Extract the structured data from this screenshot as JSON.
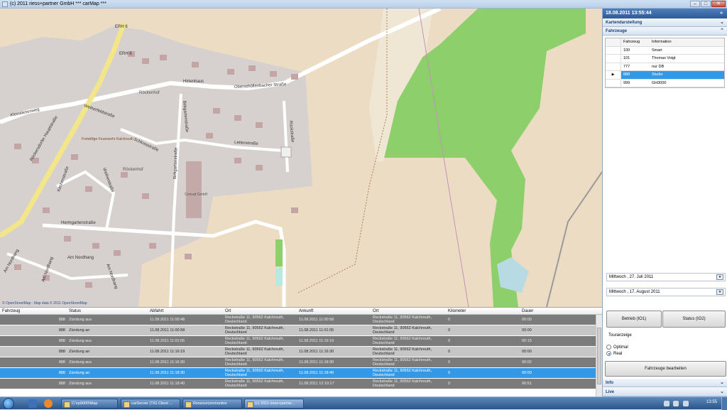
{
  "window": {
    "title": "(c) 2011 riess+partner GmbH *** carMap ***",
    "minimize": "–",
    "maximize": "□",
    "close": "✕"
  },
  "map": {
    "streets": {
      "kleewiesenweg": "Kleewiesenweg",
      "rueckersdorfer": "Röckersdorfer Hauptstraße",
      "weiherfeld": "Weiherfeldstraße",
      "schlossstrasse": "Schlossstraße",
      "birkgarten1": "Birkgartenstraße",
      "birkgarten2": "Birkgartenstraße",
      "hirtenhaus": "Hirtenhaus",
      "oberschoellenbacher": "Oberschöllenbacher Straße",
      "lettenstrasse": "Lettenstraße",
      "rueckstrasse": "Rückstraße",
      "kirchenstrasse": "Kirchenstraße",
      "weiherstrasse": "Weiherstraße",
      "hermgarten": "Hermgartenstraße",
      "am_nordhang1": "Am Nordhang",
      "am_nordhang2": "Am Nordhang",
      "am_nordhang3": "Am Nordhang",
      "am_nordhang4": "Am Nordhang",
      "erh6_1": "ERH 6",
      "erh6_2": "ERH 6",
      "rueckenhof1": "Röckenhof",
      "rueckenhof2": "Röckenhof",
      "feuerwehr": "Freiwillige Feuerwehr Kalchreuth",
      "conrad": "Conrad GmbH"
    },
    "attribution": "© OpenStreetMap - Map data © 2011 OpenStreetMap"
  },
  "grid": {
    "columns": [
      "Fahrzeug",
      "Status",
      "Abfahrt",
      "Ort",
      "Ankunft",
      "Ort",
      "Kilometer",
      "Dauer"
    ],
    "rows": [
      [
        "888",
        "Zündung aus",
        "11.08.2011 11:00:48",
        "Reckstraße 11, 90562 Kalchreuth, Deutschland",
        "11.08.2011 11:00:58",
        "Reckstraße 11, 90562 Kalchreuth, Deutschland",
        "0",
        "00:00"
      ],
      [
        "888",
        "Zündung an",
        "11.08.2011 11:00:58",
        "Reckstraße 11, 90562 Kalchreuth, Deutschland",
        "11.08.2011 11:01:05",
        "Reckstraße 11, 90562 Kalchreuth, Deutschland",
        "0",
        "00:00"
      ],
      [
        "888",
        "Zündung aus",
        "11.08.2011 11:01:05",
        "Reckstraße 11, 90562 Kalchreuth, Deutschland",
        "11.08.2011 11:16:19",
        "Reckstraße 11, 90562 Kalchreuth, Deutschland",
        "0",
        "00:15"
      ],
      [
        "888",
        "Zündung an",
        "11.08.2011 11:16:19",
        "Reckstraße 11, 90562 Kalchreuth, Deutschland",
        "11.08.2011 11:16:30",
        "Reckstraße 11, 90562 Kalchreuth, Deutschland",
        "0",
        "00:00"
      ],
      [
        "888",
        "Zündung aus",
        "11.08.2011 11:16:30",
        "Reckstraße 11, 90562 Kalchreuth, Deutschland",
        "11.08.2011 11:18:30",
        "Reckstraße 11, 90562 Kalchreuth, Deutschland",
        "0",
        "00:02"
      ],
      [
        "888",
        "Zündung an",
        "11.08.2011 11:18:30",
        "Reckstraße 11, 90562 Kalchreuth, Deutschland",
        "11.08.2011 11:18:40",
        "Reckstraße 11, 90562 Kalchreuth, Deutschland",
        "0",
        "00:00"
      ],
      [
        "888",
        "Zündung aus",
        "11.08.2011 11:18:40",
        "Reckstraße 11, 90562 Kalchreuth, Deutschland",
        "11.08.2011 12:10:17",
        "Reckstraße 11, 90562 Kalchreuth, Deutschland",
        "0",
        "00:51"
      ]
    ]
  },
  "side": {
    "datetime": "18.08.2011 13:55:44",
    "collapse_glyph": "»",
    "kartendarstellung": "Kartendarstellung",
    "fahrzeuge": "Fahrzeuge",
    "veh_headers": [
      "Fahrzeug",
      "Information"
    ],
    "vehicles": [
      [
        "100",
        "Smart"
      ],
      [
        "101",
        "Thomas Voigt"
      ],
      [
        "777",
        "nur DB"
      ],
      [
        "888",
        "Studio"
      ],
      [
        "999",
        "GH3000"
      ]
    ],
    "date_from": "Mittwoch , 27.   Juli    2011",
    "date_to": "Mittwoch , 17.  August  2011",
    "btn_betrieb": "Betrieb (IO1)",
    "btn_status": "Status (IO2)",
    "tourenanzeige": "Touranzeige",
    "radio_optimal": "Optimal",
    "radio_real": "Real",
    "btn_edit": "Fahrzeuge bearbeiten",
    "info": "Info",
    "live": "Live"
  },
  "taskbar": {
    "tasks": [
      "C:\\rp9000\\Map",
      "carServer (TIG Client ...",
      "Ressourcenmonitor",
      "(c) 2011 riess+partne..."
    ],
    "clock": "13:55"
  }
}
